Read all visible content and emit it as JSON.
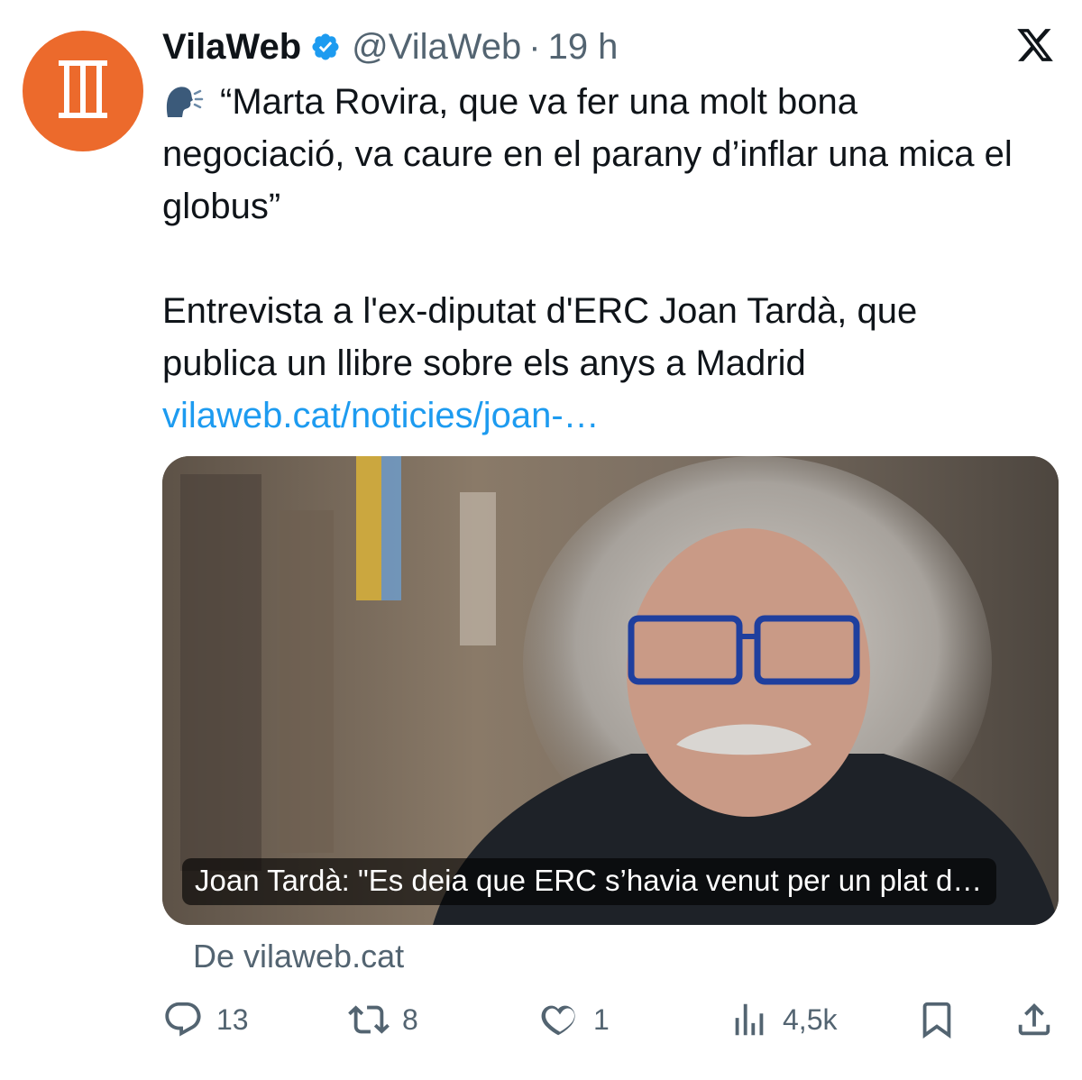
{
  "account": {
    "display_name": "VilaWeb",
    "handle": "@VilaWeb",
    "separator": "·",
    "time": "19 h",
    "verified": true,
    "avatar_color": "#ec6a2c"
  },
  "tweet": {
    "quote": "“Marta Rovira, que va fer una molt bona negociació, va caure en el parany d’inflar una mica el globus”",
    "body": "Entrevista a l'ex-diputat d'ERC Joan Tardà, que publica un llibre sobre els anys a Madrid",
    "link": "vilaweb.cat/noticies/joan-…",
    "speaker_icon": "speaking-head-icon"
  },
  "card": {
    "caption": "Joan Tardà: \"Es deia que ERC s’havia venut per un plat d…",
    "source": "De vilaweb.cat"
  },
  "actions": {
    "replies": "13",
    "retweets": "8",
    "likes": "1",
    "views": "4,5k"
  },
  "colors": {
    "link": "#1d9bf0",
    "muted": "#536471",
    "verified": "#1d9bf0"
  }
}
